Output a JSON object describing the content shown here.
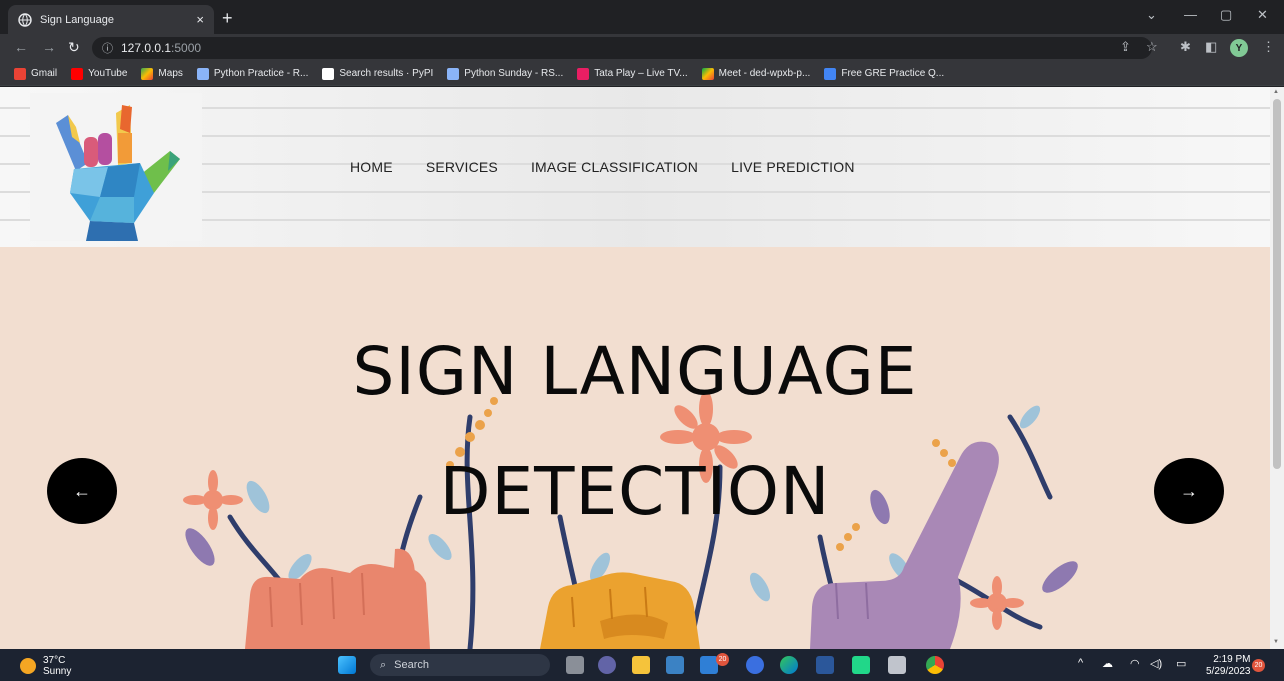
{
  "browser": {
    "tab_title": "Sign Language",
    "tab_close": "×",
    "new_tab": "+",
    "url_host": "127.0.0.1",
    "url_port": ":5000",
    "profile_initial": "Y"
  },
  "bookmarks": [
    {
      "label": "Gmail",
      "color": "#ea4335"
    },
    {
      "label": "YouTube",
      "color": "#ff0000"
    },
    {
      "label": "Maps",
      "color": "#34a853"
    },
    {
      "label": "Python Practice - R...",
      "color": "#8ab4f8"
    },
    {
      "label": "Search results · PyPI",
      "color": "#ffffff"
    },
    {
      "label": "Python Sunday - RS...",
      "color": "#8ab4f8"
    },
    {
      "label": "Tata Play – Live TV...",
      "color": "#e91e63"
    },
    {
      "label": "Meet - ded-wpxb-p...",
      "color": "#00ac47"
    },
    {
      "label": "Free GRE Practice Q...",
      "color": "#4285f4"
    }
  ],
  "site": {
    "nav": [
      "HOME",
      "SERVICES",
      "IMAGE CLASSIFICATION",
      "LIVE PREDICTION"
    ],
    "hero_line1": "SIGN LANGUAGE",
    "hero_line2": "DETECTION",
    "prev_arrow": "←",
    "next_arrow": "→"
  },
  "taskbar": {
    "temp": "37°C",
    "weather": "Sunny",
    "search_placeholder": "Search",
    "mail_badge": "20",
    "notif_badge": "20",
    "time": "2:19 PM",
    "date": "5/29/2023"
  }
}
